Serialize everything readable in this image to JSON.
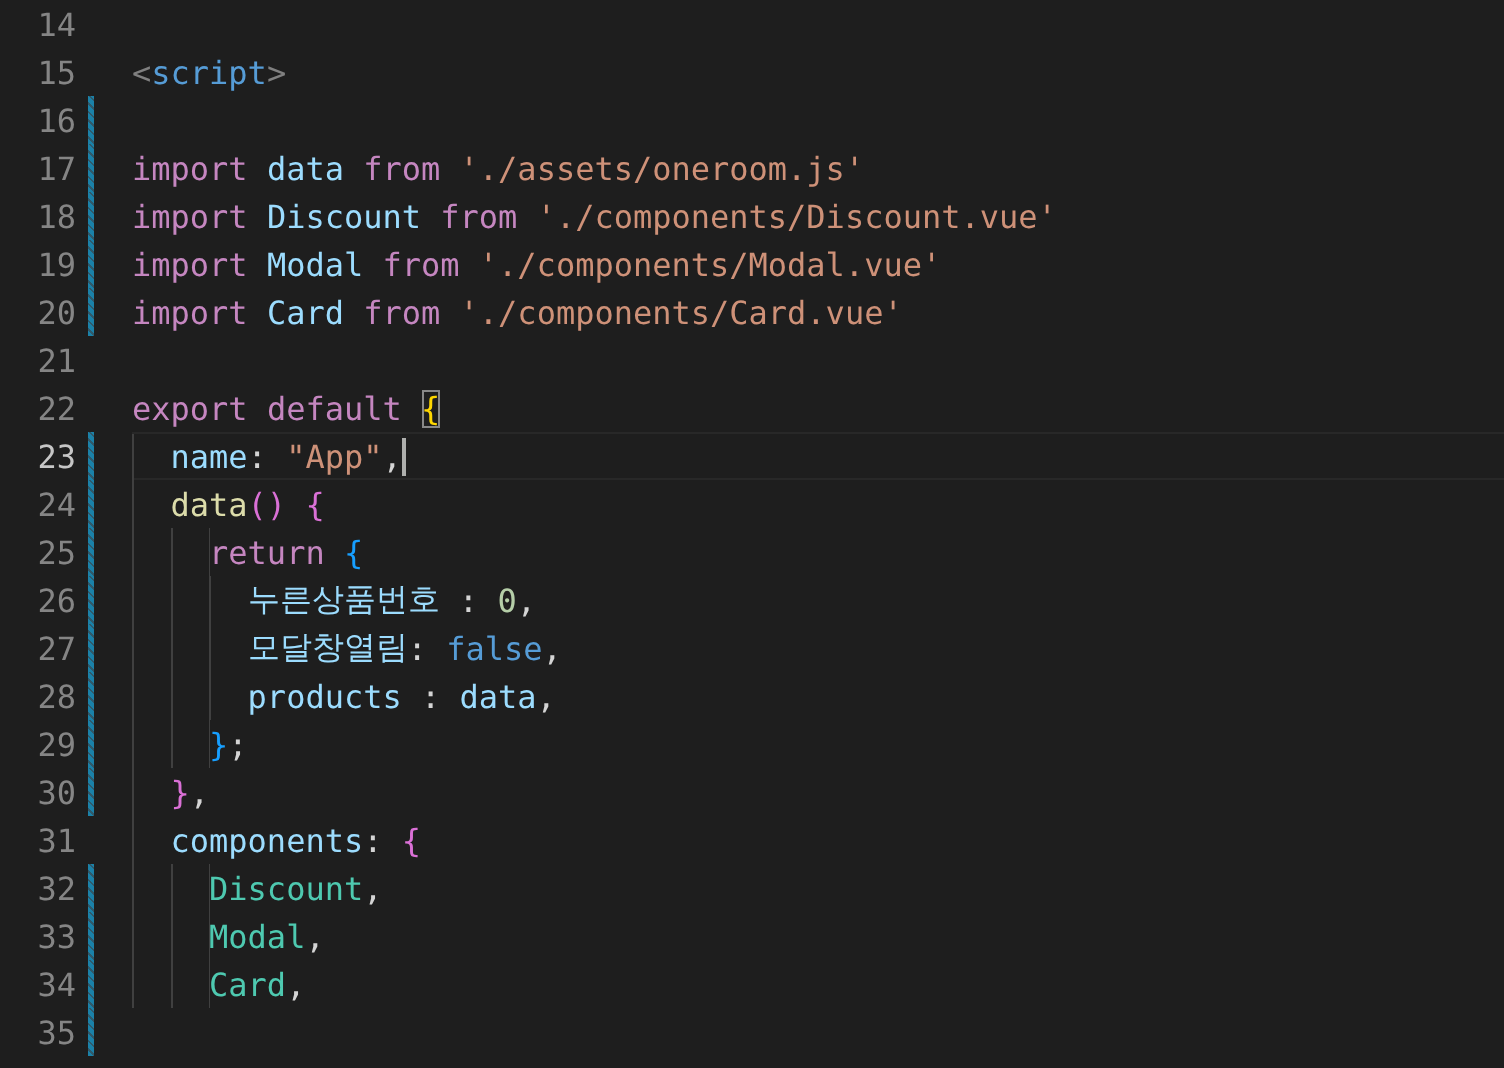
{
  "editor": {
    "lines": [
      {
        "number": "14",
        "modified": false,
        "current": false,
        "cursor": false
      },
      {
        "number": "15",
        "modified": false,
        "current": false,
        "cursor": false,
        "tokens": [
          {
            "kind": "tagpunct",
            "text": "<"
          },
          {
            "kind": "tag",
            "text": "script"
          },
          {
            "kind": "tagpunct",
            "text": ">"
          }
        ]
      },
      {
        "number": "16",
        "modified": true,
        "current": false,
        "cursor": false
      },
      {
        "number": "17",
        "modified": true,
        "current": false,
        "cursor": false,
        "tokens": [
          {
            "kind": "keyword",
            "text": "import "
          },
          {
            "kind": "variable",
            "text": "data "
          },
          {
            "kind": "keyword",
            "text": "from "
          },
          {
            "kind": "string",
            "text": "'./assets/oneroom.js'"
          }
        ]
      },
      {
        "number": "18",
        "modified": true,
        "current": false,
        "cursor": false,
        "tokens": [
          {
            "kind": "keyword",
            "text": "import "
          },
          {
            "kind": "variable",
            "text": "Discount "
          },
          {
            "kind": "keyword",
            "text": "from "
          },
          {
            "kind": "string",
            "text": "'./components/Discount.vue'"
          }
        ]
      },
      {
        "number": "19",
        "modified": true,
        "current": false,
        "cursor": false,
        "tokens": [
          {
            "kind": "keyword",
            "text": "import "
          },
          {
            "kind": "variable",
            "text": "Modal "
          },
          {
            "kind": "keyword",
            "text": "from "
          },
          {
            "kind": "string",
            "text": "'./components/Modal.vue'"
          }
        ]
      },
      {
        "number": "20",
        "modified": true,
        "current": false,
        "cursor": false,
        "tokens": [
          {
            "kind": "keyword",
            "text": "import "
          },
          {
            "kind": "variable",
            "text": "Card "
          },
          {
            "kind": "keyword",
            "text": "from "
          },
          {
            "kind": "string",
            "text": "'./components/Card.vue'"
          }
        ]
      },
      {
        "number": "21",
        "modified": false,
        "current": false,
        "cursor": false
      },
      {
        "number": "22",
        "modified": false,
        "current": false,
        "cursor": false,
        "tokens": [
          {
            "kind": "keyword",
            "text": "export "
          },
          {
            "kind": "keyword",
            "text": "default "
          },
          {
            "kind": "bracket-match",
            "text": "{"
          }
        ]
      },
      {
        "number": "23",
        "modified": true,
        "current": true,
        "cursor": true,
        "tokens": [
          {
            "kind": "variable",
            "text": "  name"
          },
          {
            "kind": "plain",
            "text": ": "
          },
          {
            "kind": "string",
            "text": "\"App\""
          },
          {
            "kind": "plain",
            "text": ","
          }
        ]
      },
      {
        "number": "24",
        "modified": true,
        "current": false,
        "cursor": false,
        "tokens": [
          {
            "kind": "function",
            "text": "  data"
          },
          {
            "kind": "brace2",
            "text": "() {"
          }
        ]
      },
      {
        "number": "25",
        "modified": true,
        "current": false,
        "cursor": false,
        "tokens": [
          {
            "kind": "keyword",
            "text": "    return "
          },
          {
            "kind": "brace3",
            "text": "{"
          }
        ]
      },
      {
        "number": "26",
        "modified": true,
        "current": false,
        "cursor": false,
        "tokens": [
          {
            "kind": "variable",
            "text": "      누른상품번호"
          },
          {
            "kind": "plain",
            "text": " : "
          },
          {
            "kind": "number",
            "text": "0"
          },
          {
            "kind": "plain",
            "text": ","
          }
        ]
      },
      {
        "number": "27",
        "modified": true,
        "current": false,
        "cursor": false,
        "tokens": [
          {
            "kind": "variable",
            "text": "      모달창열림"
          },
          {
            "kind": "plain",
            "text": ": "
          },
          {
            "kind": "constant",
            "text": "false"
          },
          {
            "kind": "plain",
            "text": ","
          }
        ]
      },
      {
        "number": "28",
        "modified": true,
        "current": false,
        "cursor": false,
        "tokens": [
          {
            "kind": "variable",
            "text": "      products"
          },
          {
            "kind": "plain",
            "text": " : "
          },
          {
            "kind": "variable",
            "text": "data"
          },
          {
            "kind": "plain",
            "text": ","
          }
        ]
      },
      {
        "number": "29",
        "modified": true,
        "current": false,
        "cursor": false,
        "tokens": [
          {
            "kind": "brace3",
            "text": "    }"
          },
          {
            "kind": "plain",
            "text": ";"
          }
        ]
      },
      {
        "number": "30",
        "modified": true,
        "current": false,
        "cursor": false,
        "tokens": [
          {
            "kind": "brace2",
            "text": "  }"
          },
          {
            "kind": "plain",
            "text": ","
          }
        ]
      },
      {
        "number": "31",
        "modified": false,
        "current": false,
        "cursor": false,
        "tokens": [
          {
            "kind": "variable",
            "text": "  components"
          },
          {
            "kind": "plain",
            "text": ": "
          },
          {
            "kind": "brace2",
            "text": "{"
          }
        ]
      },
      {
        "number": "32",
        "modified": true,
        "current": false,
        "cursor": false,
        "tokens": [
          {
            "kind": "type",
            "text": "    Discount"
          },
          {
            "kind": "plain",
            "text": ","
          }
        ]
      },
      {
        "number": "33",
        "modified": true,
        "current": false,
        "cursor": false,
        "tokens": [
          {
            "kind": "type",
            "text": "    Modal"
          },
          {
            "kind": "plain",
            "text": ","
          }
        ]
      },
      {
        "number": "34",
        "modified": true,
        "current": false,
        "cursor": false,
        "tokens": [
          {
            "kind": "type",
            "text": "    Card"
          },
          {
            "kind": "plain",
            "text": ","
          }
        ]
      },
      {
        "number": "35",
        "modified": true,
        "current": false,
        "cursor": false
      }
    ]
  }
}
